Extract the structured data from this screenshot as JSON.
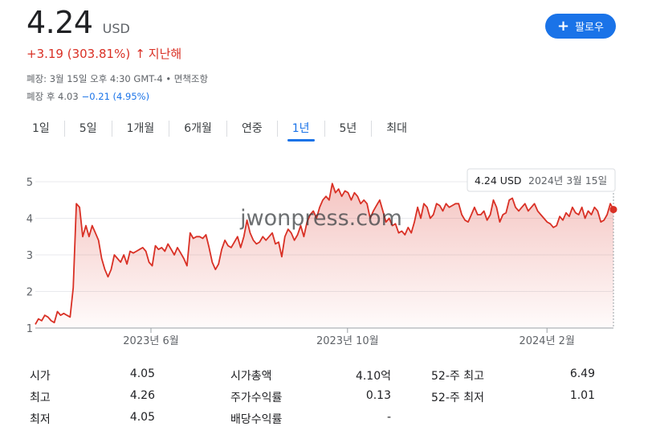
{
  "quote": {
    "price": "4.24",
    "currency": "USD",
    "change": "+3.19 (303.81%)",
    "change_arrow": "↑",
    "change_period": "지난해",
    "close_info": "폐장: 3월 15일 오후 4:30 GMT-4 • 면책조항",
    "after_hours_label": "폐장 후 4.03",
    "after_hours_change": "−0.21 (4.95%)"
  },
  "follow_button": {
    "icon": "plus-icon",
    "label": "팔로우"
  },
  "tabs": [
    {
      "label": "1일",
      "active": false
    },
    {
      "label": "5일",
      "active": false
    },
    {
      "label": "1개월",
      "active": false
    },
    {
      "label": "6개월",
      "active": false
    },
    {
      "label": "연중",
      "active": false
    },
    {
      "label": "1년",
      "active": true
    },
    {
      "label": "5년",
      "active": false
    },
    {
      "label": "최대",
      "active": false
    }
  ],
  "watermark": "jwonpress.com",
  "chart_data": {
    "type": "area",
    "title": "",
    "xlabel": "",
    "ylabel": "",
    "ylim": [
      1,
      5
    ],
    "y_ticks": [
      "1",
      "2",
      "3",
      "4",
      "5"
    ],
    "x_ticks": [
      {
        "label": "2023년 6월",
        "t": 0.2
      },
      {
        "label": "2023년 10월",
        "t": 0.54
      },
      {
        "label": "2024년 2월",
        "t": 0.885
      }
    ],
    "grid": true,
    "line_color": "#d93025",
    "tooltip": {
      "value": "4.24 USD",
      "date": "2024년 3월 15일"
    },
    "series": [
      {
        "values": [
          1.1,
          1.25,
          1.2,
          1.35,
          1.3,
          1.2,
          1.15,
          1.45,
          1.35,
          1.4,
          1.35,
          1.3,
          2.1,
          4.4,
          4.3,
          3.5,
          3.8,
          3.5,
          3.8,
          3.6,
          3.4,
          2.9,
          2.6,
          2.4,
          2.6,
          3.0,
          2.9,
          2.8,
          3.0,
          2.75,
          3.1,
          3.05,
          3.1,
          3.15,
          3.2,
          3.1,
          2.8,
          2.7,
          3.25,
          3.15,
          3.2,
          3.1,
          3.3,
          3.15,
          3.0,
          3.2,
          3.05,
          2.9,
          2.7,
          3.6,
          3.45,
          3.5,
          3.5,
          3.45,
          3.55,
          3.2,
          2.8,
          2.6,
          2.75,
          3.15,
          3.4,
          3.25,
          3.2,
          3.35,
          3.5,
          3.2,
          3.5,
          3.95,
          3.6,
          3.4,
          3.3,
          3.35,
          3.5,
          3.4,
          3.5,
          3.6,
          3.3,
          3.35,
          2.95,
          3.5,
          3.7,
          3.6,
          3.4,
          3.55,
          3.8,
          3.5,
          3.9,
          4.1,
          4.2,
          4.0,
          4.3,
          4.5,
          4.6,
          4.5,
          4.95,
          4.7,
          4.8,
          4.6,
          4.75,
          4.7,
          4.5,
          4.7,
          4.6,
          4.4,
          4.5,
          4.4,
          4.0,
          4.2,
          4.35,
          4.5,
          4.2,
          3.9,
          4.0,
          3.8,
          3.85,
          3.6,
          3.65,
          3.55,
          3.75,
          3.6,
          3.9,
          4.3,
          4.0,
          4.4,
          4.3,
          4.0,
          4.1,
          4.4,
          4.35,
          4.2,
          4.4,
          4.3,
          4.35,
          4.4,
          4.4,
          4.1,
          3.95,
          3.9,
          4.1,
          4.3,
          4.1,
          4.1,
          4.2,
          3.95,
          4.1,
          4.5,
          4.3,
          3.9,
          4.1,
          4.15,
          4.5,
          4.55,
          4.3,
          4.2,
          4.3,
          4.4,
          4.2,
          4.3,
          4.4,
          4.2,
          4.1,
          4.0,
          3.9,
          3.85,
          3.75,
          3.8,
          4.05,
          3.95,
          4.15,
          4.05,
          4.3,
          4.15,
          4.1,
          4.3,
          4.0,
          4.2,
          4.1,
          4.3,
          4.2,
          3.9,
          3.95,
          4.1,
          4.4,
          4.24
        ]
      }
    ]
  },
  "stats": [
    {
      "label": "시가",
      "value": "4.05"
    },
    {
      "label": "최고",
      "value": "4.26"
    },
    {
      "label": "최저",
      "value": "4.05"
    },
    {
      "label": "시가총액",
      "value": "4.10억"
    },
    {
      "label": "주가수익률",
      "value": "0.13"
    },
    {
      "label": "배당수익률",
      "value": "-"
    },
    {
      "label": "52-주 최고",
      "value": "6.49"
    },
    {
      "label": "52-주 최저",
      "value": "1.01"
    }
  ]
}
